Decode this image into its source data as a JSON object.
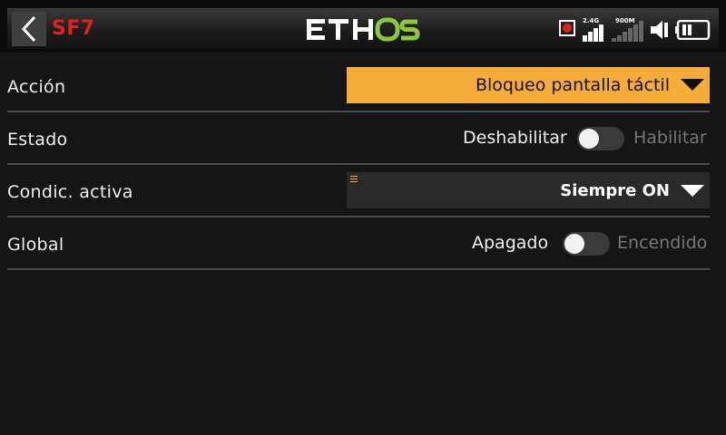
{
  "header": {
    "sf_label": "SF7",
    "logo_text": "ETHOS",
    "logo_colors": {
      "eth": "#ffffff",
      "os": "#8dc63f"
    },
    "status": {
      "rec_icon": "record-icon",
      "rf_24g_label": "2.4G",
      "rf_900m_label": "900M",
      "speaker_icon": "speaker-icon",
      "battery_icon": "battery-icon"
    }
  },
  "rows": {
    "accion": {
      "label": "Acción",
      "value": "Bloqueo pantalla táctil"
    },
    "estado": {
      "label": "Estado",
      "off_label": "Deshabilitar",
      "on_label": "Habilitar",
      "checked": false
    },
    "condicion": {
      "label": "Condic. activa",
      "value": "Siempre ON"
    },
    "global": {
      "label": "Global",
      "off_label": "Apagado",
      "on_label": "Encendido",
      "checked": false
    }
  },
  "colors": {
    "accent_orange": "#f5ac38",
    "sf_red": "#e0211e",
    "background": "#151515"
  }
}
